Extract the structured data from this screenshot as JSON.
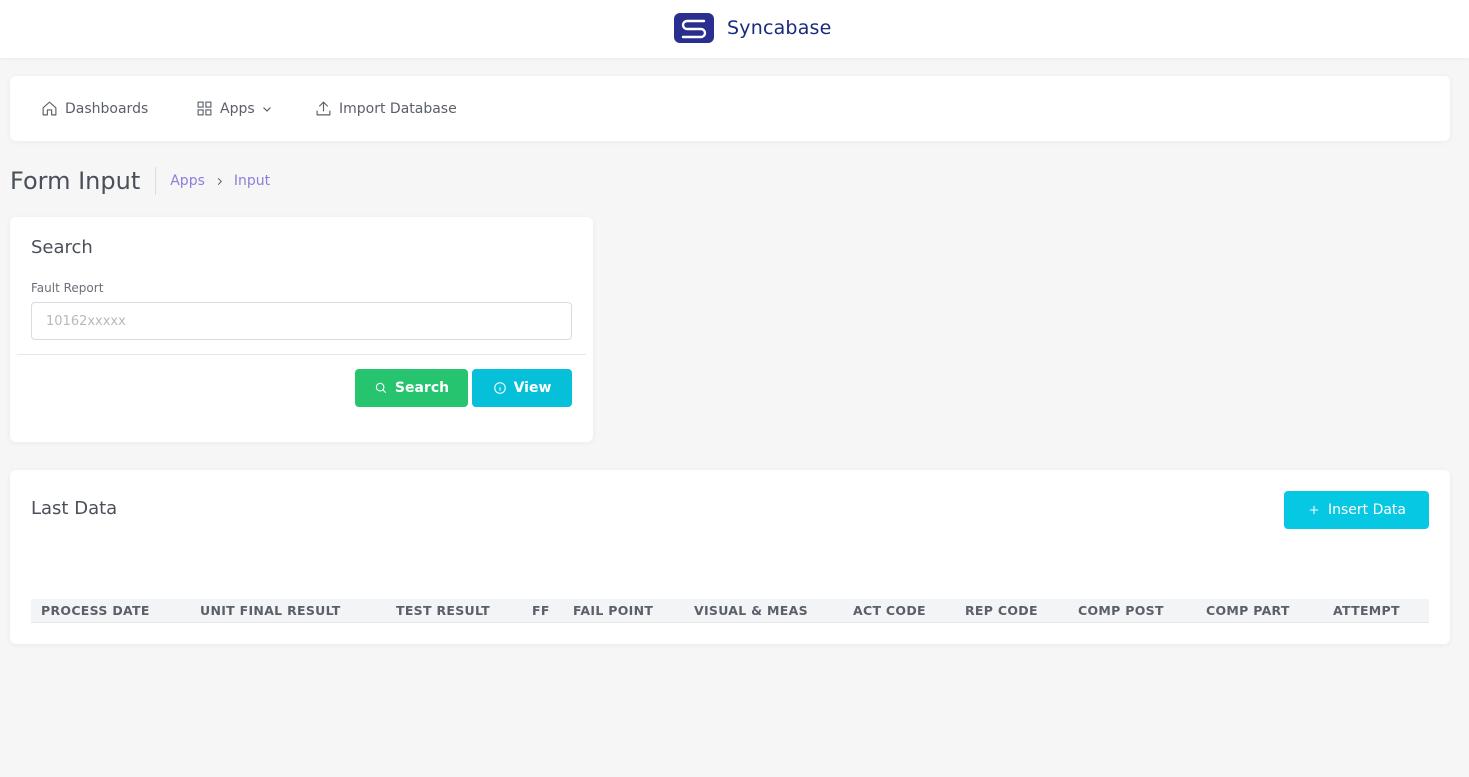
{
  "brand": {
    "name": "Syncabase",
    "logo_icon": "syncabase-s-logo",
    "color": "#1a2a7c"
  },
  "nav": {
    "items": [
      {
        "label": "Dashboards",
        "icon": "home-icon"
      },
      {
        "label": "Apps",
        "icon": "grid-icon",
        "dropdown": true
      },
      {
        "label": "Import Database",
        "icon": "upload-icon"
      }
    ]
  },
  "page": {
    "title": "Form Input",
    "breadcrumb": [
      "Apps",
      "Input"
    ],
    "breadcrumb_color": "#8b7fd9"
  },
  "search_card": {
    "title": "Search",
    "field_label": "Fault Report",
    "field_value": "",
    "field_placeholder": "10162xxxxx",
    "search_button": "Search",
    "view_button": "View",
    "search_color": "#26c46f",
    "view_color": "#06bfd9"
  },
  "data_card": {
    "title": "Last Data",
    "insert_button": "Insert Data",
    "insert_color": "#06c8e2",
    "columns": [
      "PROCESS DATE",
      "UNIT FINAL RESULT",
      "TEST RESULT",
      "FF",
      "FAIL POINT",
      "VISUAL & MEAS",
      "ACT CODE",
      "REP CODE",
      "COMP POST",
      "COMP PART",
      "ATTEMPT"
    ],
    "rows": []
  }
}
